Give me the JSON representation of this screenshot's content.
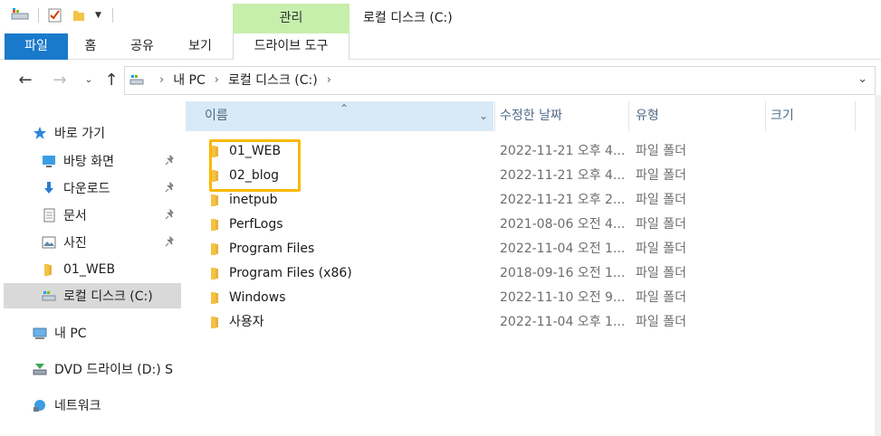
{
  "window": {
    "title": "로컬 디스크 (C:)",
    "context_tab": "관리"
  },
  "ribbon": {
    "tabs": [
      {
        "label": "파일"
      },
      {
        "label": "홈"
      },
      {
        "label": "공유"
      },
      {
        "label": "보기"
      },
      {
        "label": "드라이브 도구"
      }
    ]
  },
  "address": {
    "crumbs": [
      "내 PC",
      "로컬 디스크 (C:)"
    ]
  },
  "nav": {
    "quick_access": "바로 가기",
    "items": [
      {
        "label": "바탕 화면",
        "icon": "desktop-icon",
        "pinned": true
      },
      {
        "label": "다운로드",
        "icon": "download-icon",
        "pinned": true
      },
      {
        "label": "문서",
        "icon": "document-icon",
        "pinned": true
      },
      {
        "label": "사진",
        "icon": "picture-icon",
        "pinned": true
      },
      {
        "label": "01_WEB",
        "icon": "folder-icon",
        "pinned": false
      },
      {
        "label": "로컬 디스크 (C:)",
        "icon": "drive-icon",
        "pinned": false
      }
    ],
    "this_pc": "내 PC",
    "dvd": "DVD 드라이브 (D:) S",
    "network": "네트워크"
  },
  "columns": {
    "name": "이름",
    "date": "수정한 날짜",
    "type": "유형",
    "size": "크기"
  },
  "files": [
    {
      "name": "01_WEB",
      "date": "2022-11-21 오후 4...",
      "type": "파일 폴더"
    },
    {
      "name": "02_blog",
      "date": "2022-11-21 오후 4...",
      "type": "파일 폴더"
    },
    {
      "name": "inetpub",
      "date": "2022-11-21 오후 2...",
      "type": "파일 폴더"
    },
    {
      "name": "PerfLogs",
      "date": "2021-08-06 오전 4...",
      "type": "파일 폴더"
    },
    {
      "name": "Program Files",
      "date": "2022-11-04 오전 1...",
      "type": "파일 폴더"
    },
    {
      "name": "Program Files (x86)",
      "date": "2018-09-16 오전 1...",
      "type": "파일 폴더"
    },
    {
      "name": "Windows",
      "date": "2022-11-10 오전 9...",
      "type": "파일 폴더"
    },
    {
      "name": "사용자",
      "date": "2022-11-04 오후 1...",
      "type": "파일 폴더"
    }
  ],
  "colors": {
    "folder": "#f4c346",
    "accent": "#1979ca",
    "context_tab": "#c6efac",
    "highlight": "#f9b800",
    "selected_header": "#d8eaf7"
  }
}
